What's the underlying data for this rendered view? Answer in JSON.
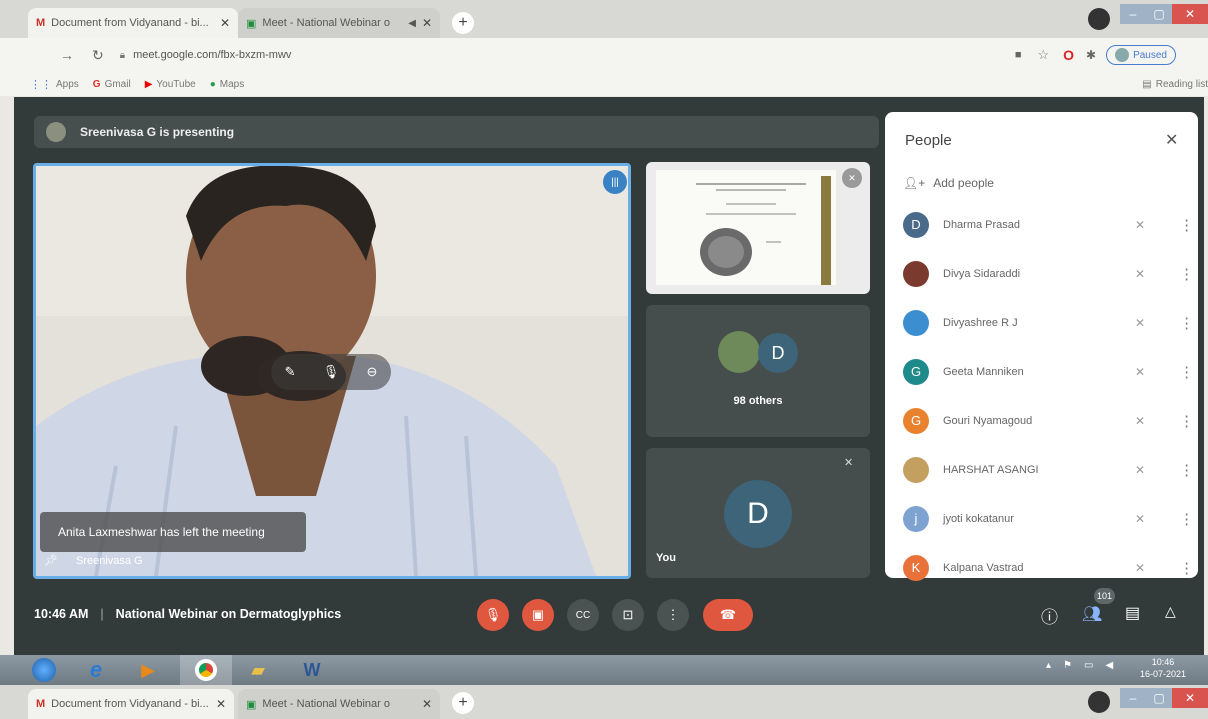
{
  "browser": {
    "tabs": [
      {
        "title": "Document from Vidyanand - bi..."
      },
      {
        "title": "Meet - National Webinar o"
      }
    ],
    "url": "meet.google.com/fbx-bxzm-mwv",
    "profile_status": "Paused",
    "bookmarks": [
      "Apps",
      "Gmail",
      "YouTube",
      "Maps"
    ],
    "reading_list": "Reading list"
  },
  "meet": {
    "presenting_text": "Sreenivasa G is presenting",
    "main_speaker_name": "Sreenivasa G",
    "toast": "Anita Laxmeshwar has left the meeting",
    "others_count_text": "98 others",
    "others_avatar_letter": "D",
    "self_label": "You",
    "self_avatar_letter": "D",
    "time": "10:46 AM",
    "meeting_title": "National Webinar on Dermatoglyphics",
    "participants_badge": "101"
  },
  "people_panel": {
    "title": "People",
    "add_people": "Add people",
    "participants": [
      {
        "name": "Dharma Prasad",
        "initial": "D",
        "color": "#4a6a8a"
      },
      {
        "name": "Divya Sidaraddi",
        "initial": "",
        "color": "#7a3b2e"
      },
      {
        "name": "Divyashree R J",
        "initial": "",
        "color": "#3b8fd0"
      },
      {
        "name": "Geeta Manniken",
        "initial": "G",
        "color": "#1f8a8a"
      },
      {
        "name": "Gouri Nyamagoud",
        "initial": "G",
        "color": "#e8822e"
      },
      {
        "name": "HARSHAT ASANGI",
        "initial": "",
        "color": "#c4a060"
      },
      {
        "name": "jyoti kokatanur",
        "initial": "j",
        "color": "#7fa3d1"
      },
      {
        "name": "Kalpana Vastrad",
        "initial": "K",
        "color": "#e8723a"
      }
    ]
  },
  "taskbar": {
    "clock_time": "10:46",
    "clock_date": "16-07-2021"
  },
  "colors": {
    "meet_bg": "#333a3a",
    "end_call": "#e0573f",
    "muted_btn": "#e0573f",
    "speaker_border": "#6aaee8"
  }
}
